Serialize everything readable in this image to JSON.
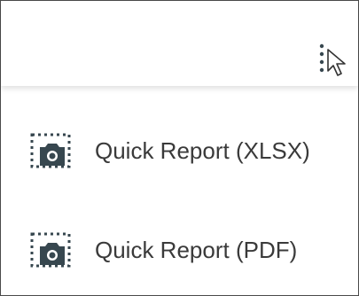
{
  "toolbar": {
    "more_icon": "more-vertical-icon",
    "cursor_icon": "mouse-pointer-icon"
  },
  "menu": {
    "items": [
      {
        "label": "Quick Report (XLSX)",
        "icon": "camera-snapshot-icon"
      },
      {
        "label": "Quick Report (PDF)",
        "icon": "camera-snapshot-icon"
      }
    ]
  },
  "colors": {
    "text": "#3a3a3a",
    "icon": "#37474f",
    "border": "#4a4a4a"
  }
}
